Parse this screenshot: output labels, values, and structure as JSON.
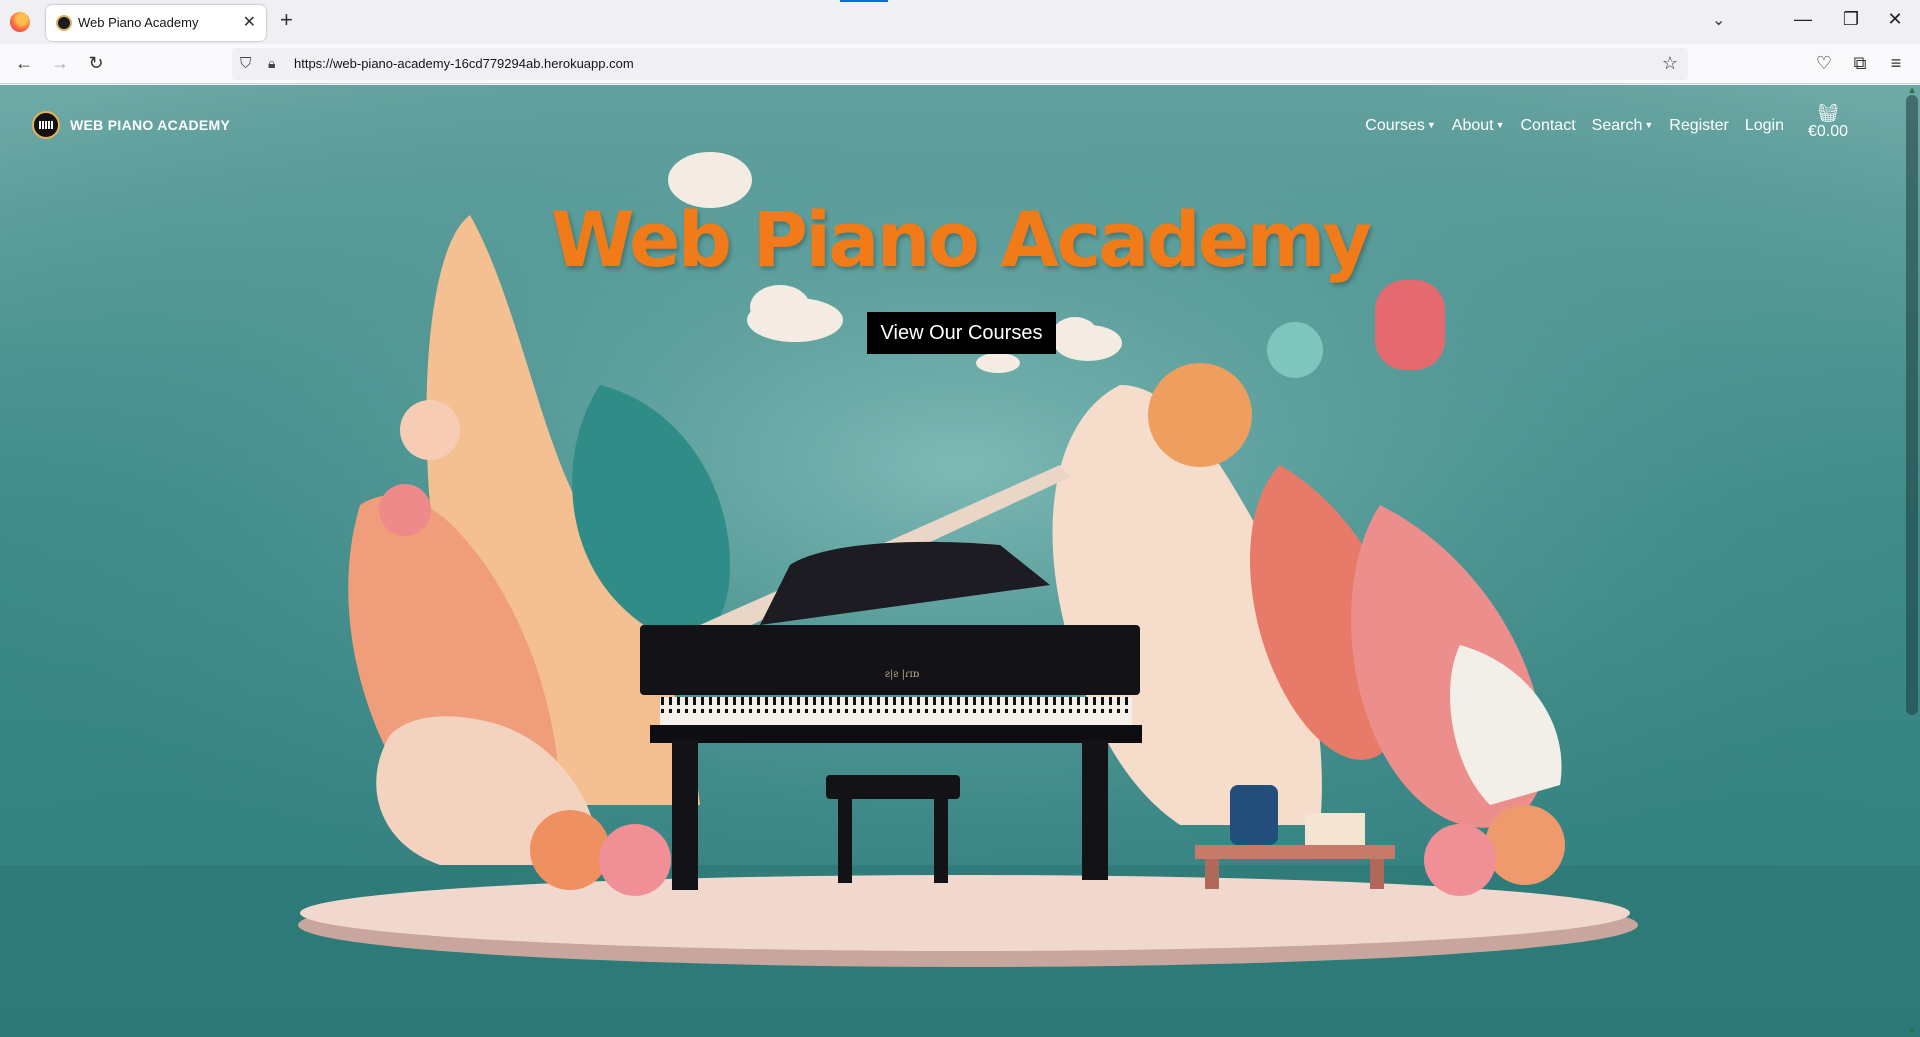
{
  "browser": {
    "tab_title": "Web Piano Academy",
    "tab_close": "✕",
    "new_tab": "+",
    "url": "https://web-piano-academy-16cd779294ab.herokuapp.com",
    "window_controls": {
      "minimize": "—",
      "restore": "❐",
      "close": "✕"
    },
    "icons": [
      "firefox-logo",
      "back-arrow",
      "forward-arrow",
      "reload",
      "shield",
      "lock",
      "bookmark-star",
      "pocket",
      "extensions",
      "menu"
    ]
  },
  "site": {
    "brand": "WEB PIANO ACADEMY",
    "nav": [
      {
        "label": "Courses",
        "dropdown": true
      },
      {
        "label": "About",
        "dropdown": true
      },
      {
        "label": "Contact",
        "dropdown": false
      },
      {
        "label": "Search",
        "dropdown": true
      },
      {
        "label": "Register",
        "dropdown": false
      },
      {
        "label": "Login",
        "dropdown": false
      }
    ],
    "cart_total": "€0.00",
    "hero_title": "Web Piano Academy",
    "cta_label": "View Our Courses",
    "piano_brand": "ƨ|ƨ |ɾɪɒ"
  },
  "colors": {
    "hero_title": "#f07b18",
    "background_teal": "#3f8d8b",
    "cta_bg": "#000000"
  }
}
